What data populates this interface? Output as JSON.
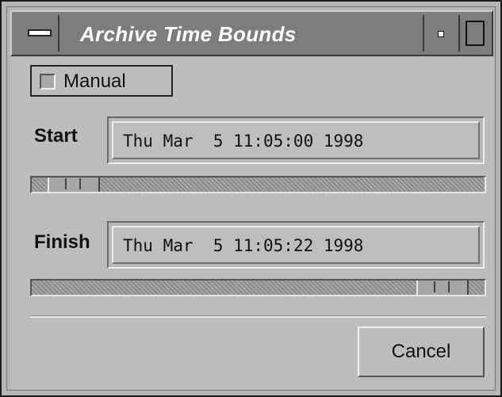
{
  "window": {
    "title": "Archive Time Bounds"
  },
  "manual_toggle": {
    "label": "Manual",
    "checked": false
  },
  "start": {
    "label": "Start",
    "value": "Thu Mar  5 11:05:00 1998",
    "slider_position": 0.04
  },
  "finish": {
    "label": "Finish",
    "value": "Thu Mar  5 11:05:22 1998",
    "slider_position": 0.96
  },
  "buttons": {
    "cancel_label": "Cancel"
  },
  "icons": {
    "window_menu": "window-menu-icon",
    "minimize": "minimize-icon",
    "maximize": "maximize-icon"
  },
  "colors": {
    "titlebar": "#7d7d7d",
    "background": "#bdbdbd"
  }
}
